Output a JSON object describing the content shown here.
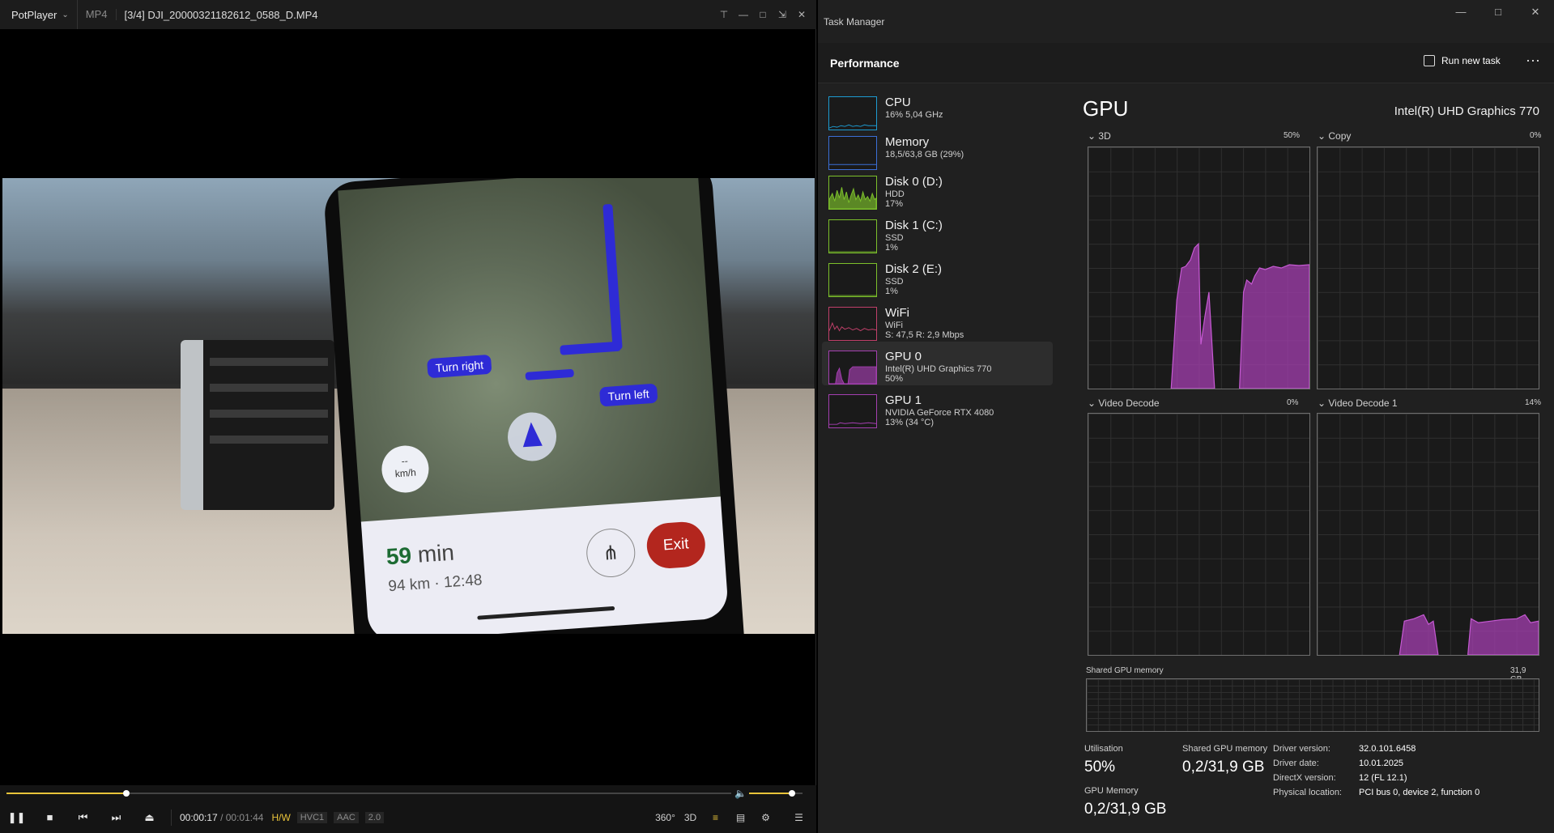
{
  "potplayer": {
    "brand": "PotPlayer",
    "format": "MP4",
    "file_title": "[3/4] DJI_20000321182612_0588_D.MP4",
    "time_current": "00:00:17",
    "time_separator": "/",
    "time_total": "00:01:44",
    "hw_label": "H/W",
    "codec_video": "HVC1",
    "codec_audio": "AAC",
    "channels": "2.0",
    "seek_progress": 0.165,
    "volume_level": 0.8,
    "right_controls": {
      "vr": "360°",
      "three_d": "3D"
    },
    "video_scene": {
      "turn_right": "Turn right",
      "turn_left": "Turn left",
      "speed_value": "--",
      "speed_unit": "km/h",
      "eta_value": "59",
      "eta_unit": "min",
      "eta_detail": "94 km · 12:48",
      "exit_label": "Exit"
    },
    "accent_color": "#e8c33a"
  },
  "taskmgr": {
    "window_title": "Task Manager",
    "section_title": "Performance",
    "run_new_task": "Run new task",
    "sidebar": [
      {
        "name": "CPU",
        "lines": [
          "16% 5,04 GHz"
        ],
        "color": "#1d9bd1"
      },
      {
        "name": "Memory",
        "lines": [
          "18,5/63,8 GB (29%)"
        ],
        "color": "#3b6fd6"
      },
      {
        "name": "Disk 0 (D:)",
        "lines": [
          "HDD",
          "17%"
        ],
        "color": "#7cc02b"
      },
      {
        "name": "Disk 1 (C:)",
        "lines": [
          "SSD",
          "1%"
        ],
        "color": "#7cc02b"
      },
      {
        "name": "Disk 2 (E:)",
        "lines": [
          "SSD",
          "1%"
        ],
        "color": "#7cc02b"
      },
      {
        "name": "WiFi",
        "lines": [
          "WiFi",
          "S: 47,5 R: 2,9 Mbps"
        ],
        "color": "#c0406a"
      },
      {
        "name": "GPU 0",
        "lines": [
          "Intel(R) UHD Graphics 770",
          "50%"
        ],
        "color": "#a43fb0"
      },
      {
        "name": "GPU 1",
        "lines": [
          "NVIDIA GeForce RTX 4080",
          "13% (34 °C)"
        ],
        "color": "#a43fb0"
      }
    ],
    "gpu": {
      "heading": "GPU",
      "model": "Intel(R) UHD Graphics 770",
      "graphs": [
        {
          "label": "3D",
          "pct": "50%"
        },
        {
          "label": "Copy",
          "pct": "0%"
        },
        {
          "label": "Video Decode",
          "pct": "0%"
        },
        {
          "label": "Video Decode 1",
          "pct": "14%"
        }
      ],
      "shared_mem_label": "Shared GPU memory",
      "shared_mem_total": "31,9 GB",
      "stats": {
        "utilisation_label": "Utilisation",
        "utilisation_value": "50%",
        "shared_label": "Shared GPU memory",
        "shared_value": "0,2/31,9 GB",
        "gpu_mem_label": "GPU Memory",
        "gpu_mem_value": "0,2/31,9 GB"
      },
      "driver": [
        {
          "k": "Driver version:",
          "v": "32.0.101.6458"
        },
        {
          "k": "Driver date:",
          "v": "10.01.2025"
        },
        {
          "k": "DirectX version:",
          "v": "12 (FL 12.1)"
        },
        {
          "k": "Physical location:",
          "v": "PCI bus 0, device 2, function 0"
        }
      ],
      "graph_color": "#a43fb0"
    }
  }
}
